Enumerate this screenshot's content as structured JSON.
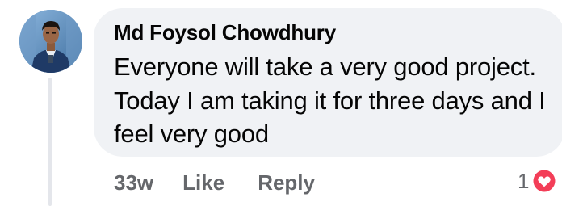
{
  "comment": {
    "author": "Md Foysol Chowdhury",
    "text": "Everyone will take a very good project. Today I am taking it for three days and I feel very good",
    "timestamp": "33w",
    "like_label": "Like",
    "reply_label": "Reply",
    "reaction_count": "1",
    "reaction_icon": "heart-icon"
  },
  "colors": {
    "bubble": "#f0f2f5",
    "meta_text": "#65676b",
    "heart": "#f33e58"
  }
}
